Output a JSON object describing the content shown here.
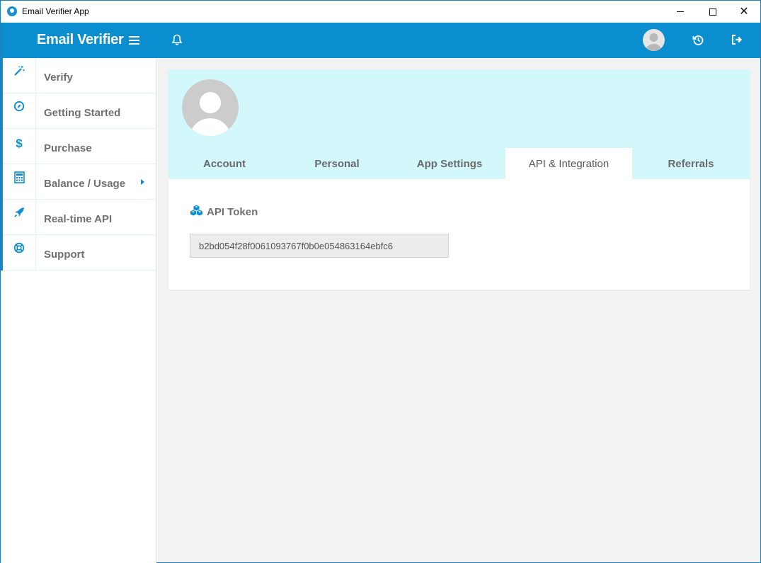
{
  "window": {
    "title": "Email Verifier App",
    "min_icon": "minimize-icon",
    "max_icon": "maximize-icon",
    "close_glyph": "✕"
  },
  "header": {
    "brand": "Email Verifier",
    "accent_color": "#0a8ecf"
  },
  "sidebar": {
    "items": [
      {
        "label": "Verify",
        "icon": "magic-wand-icon"
      },
      {
        "label": "Getting Started",
        "icon": "compass-icon"
      },
      {
        "label": "Purchase",
        "icon": "dollar-icon",
        "glyph": "$"
      },
      {
        "label": "Balance / Usage",
        "icon": "calculator-icon",
        "has_submenu": true
      },
      {
        "label": "Real-time API",
        "icon": "rocket-icon"
      },
      {
        "label": "Support",
        "icon": "life-ring-icon"
      }
    ]
  },
  "profile": {
    "tabs": [
      {
        "label": "Account",
        "active": false
      },
      {
        "label": "Personal",
        "active": false
      },
      {
        "label": "App Settings",
        "active": false
      },
      {
        "label": "API & Integration",
        "active": true
      },
      {
        "label": "Referrals",
        "active": false
      }
    ]
  },
  "api": {
    "token_label": "API Token",
    "token_value": "b2bd054f28f0061093767f0b0e054863164ebfc6"
  }
}
